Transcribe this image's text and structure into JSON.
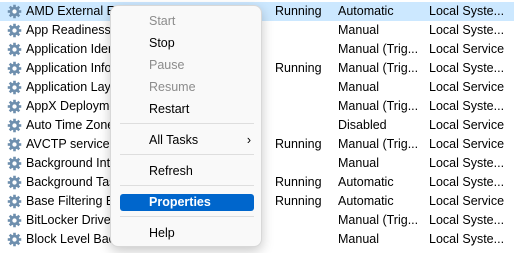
{
  "services": [
    {
      "name": "AMD External Ev",
      "status": "Running",
      "startup": "Automatic",
      "logon": "Local Syste..."
    },
    {
      "name": "App Readiness",
      "status": "",
      "startup": "Manual",
      "logon": "Local Syste..."
    },
    {
      "name": "Application Ider",
      "status": "",
      "startup": "Manual (Trig...",
      "logon": "Local Service"
    },
    {
      "name": "Application Info",
      "status": "Running",
      "startup": "Manual (Trig...",
      "logon": "Local Syste..."
    },
    {
      "name": "Application Laye",
      "status": "",
      "startup": "Manual",
      "logon": "Local Service"
    },
    {
      "name": "AppX Deployme",
      "status": "",
      "startup": "Manual (Trig...",
      "logon": "Local Syste..."
    },
    {
      "name": "Auto Time Zone",
      "status": "",
      "startup": "Disabled",
      "logon": "Local Service"
    },
    {
      "name": "AVCTP service",
      "status": "Running",
      "startup": "Manual (Trig...",
      "logon": "Local Service"
    },
    {
      "name": "Background Inte",
      "status": "",
      "startup": "Manual",
      "logon": "Local Syste..."
    },
    {
      "name": "Background Tas",
      "status": "Running",
      "startup": "Automatic",
      "logon": "Local Syste..."
    },
    {
      "name": "Base Filtering Er",
      "status": "Running",
      "startup": "Automatic",
      "logon": "Local Service"
    },
    {
      "name": "BitLocker Drive I",
      "status": "",
      "startup": "Manual (Trig...",
      "logon": "Local Syste..."
    },
    {
      "name": "Block Level Back",
      "status": "",
      "startup": "Manual",
      "logon": "Local Syste..."
    }
  ],
  "context_menu": {
    "start": "Start",
    "stop": "Stop",
    "pause": "Pause",
    "resume": "Resume",
    "restart": "Restart",
    "all_tasks": "All Tasks",
    "all_tasks_chevron": "›",
    "refresh": "Refresh",
    "properties": "Properties",
    "help": "Help"
  },
  "colors": {
    "selection": "#cce8ff",
    "menu_highlight": "#0066cc"
  }
}
